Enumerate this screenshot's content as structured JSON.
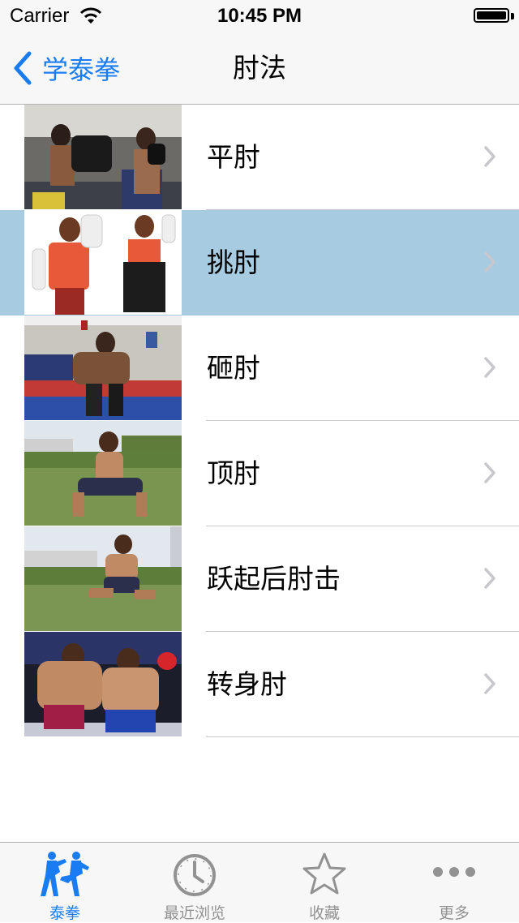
{
  "status_bar": {
    "carrier": "Carrier",
    "time": "10:45 PM",
    "battery_level": 1.0
  },
  "nav": {
    "back_label": "学泰拳",
    "title": "肘法"
  },
  "list": {
    "selected_index": 1,
    "items": [
      {
        "label": "平肘",
        "thumbnail": "photo-trainer-pads-gym"
      },
      {
        "label": "挑肘",
        "thumbnail": "photo-boxer-guard-white-bg"
      },
      {
        "label": "砸肘",
        "thumbnail": "photo-clinch-gym"
      },
      {
        "label": "顶肘",
        "thumbnail": "photo-stance-grass-field"
      },
      {
        "label": "跃起后肘击",
        "thumbnail": "photo-jump-grass-field"
      },
      {
        "label": "转身肘",
        "thumbnail": "photo-ring-fight"
      }
    ]
  },
  "tab_bar": {
    "active_index": 0,
    "tabs": [
      {
        "label": "泰拳",
        "icon": "kickboxers-icon"
      },
      {
        "label": "最近浏览",
        "icon": "clock-icon"
      },
      {
        "label": "收藏",
        "icon": "star-icon"
      },
      {
        "label": "更多",
        "icon": "more-dots-icon"
      }
    ]
  },
  "colors": {
    "accent": "#1a7cf2",
    "selected_row": "#a7cbe0",
    "inactive": "#929292"
  }
}
